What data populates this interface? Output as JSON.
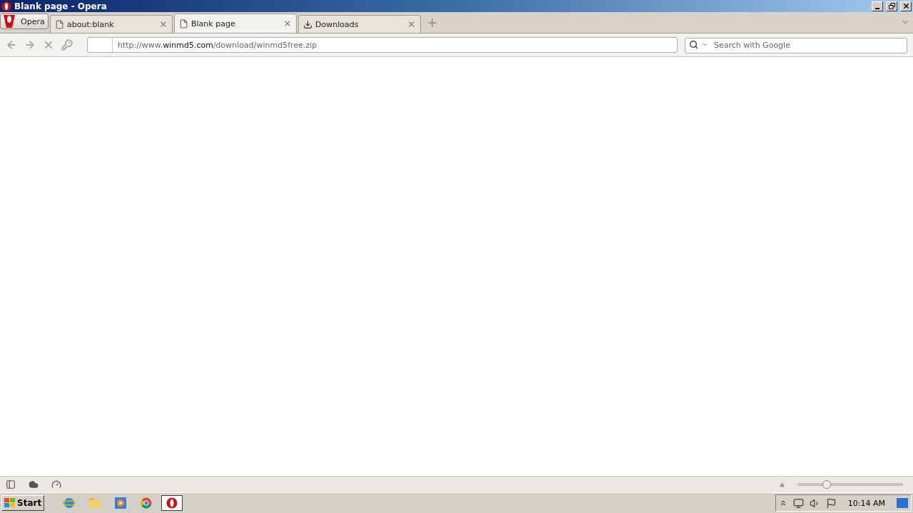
{
  "window": {
    "title": "Blank page - Opera"
  },
  "menu_button": {
    "label": "Opera"
  },
  "tabs": [
    {
      "label": "about:blank",
      "kind": "page",
      "selected": false
    },
    {
      "label": "Blank page",
      "kind": "page",
      "selected": true
    },
    {
      "label": "Downloads",
      "kind": "downloads",
      "selected": false
    }
  ],
  "address_bar": {
    "url": "http://www.**winmd5.com**/download/winmd5free.zip"
  },
  "search": {
    "placeholder": "Search with Google"
  },
  "zoom_slider": {
    "level": 0.28
  },
  "taskbar": {
    "start": "Start",
    "apps": [
      {
        "kind": "ie",
        "selected": false
      },
      {
        "kind": "folder",
        "selected": false
      },
      {
        "kind": "media",
        "selected": false
      },
      {
        "kind": "chrome",
        "selected": false
      },
      {
        "kind": "opera",
        "selected": true
      }
    ],
    "clock": "10:14 AM"
  }
}
